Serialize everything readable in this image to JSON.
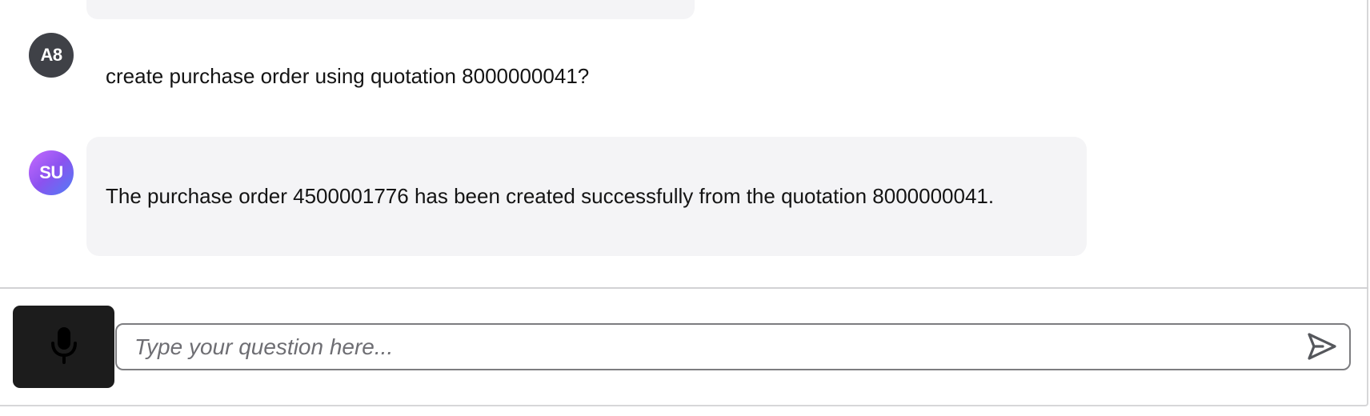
{
  "messages": [
    {
      "role": "user",
      "avatar_initials": "A8",
      "text": "create purchase order using quotation 8000000041?"
    },
    {
      "role": "assistant",
      "avatar_initials": "SU",
      "text": "The purchase order 4500001776 has been created successfully from the quotation 8000000041."
    }
  ],
  "composer": {
    "placeholder": "Type your question here...",
    "value": "",
    "mic_icon": "microphone-icon",
    "send_icon": "send-icon"
  },
  "colors": {
    "user_avatar": "#3f4147",
    "assistant_avatar_gradient": [
      "#c66bff",
      "#8b52ef",
      "#4f7ef5"
    ],
    "bubble_background": "#f4f4f6",
    "mic_button_background": "#1c1c1c"
  }
}
